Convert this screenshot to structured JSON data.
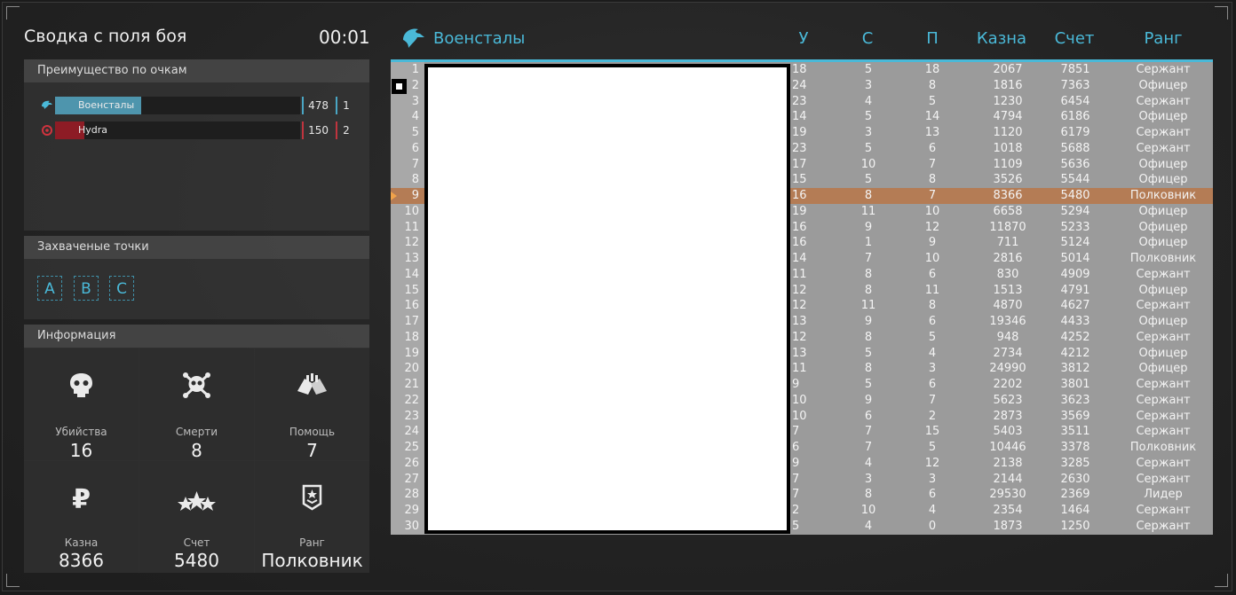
{
  "summary": {
    "title": "Сводка с поля боя",
    "timer": "00:01"
  },
  "advantage": {
    "heading": "Преимущество по очкам",
    "teams": [
      {
        "name": "Военсталы",
        "score": "478",
        "place": "1",
        "fill": 0.35,
        "color": "#4e95ad"
      },
      {
        "name": "Hydra",
        "score": "150",
        "place": "2",
        "fill": 0.12,
        "color": "#8d1c25"
      }
    ]
  },
  "captured": {
    "heading": "Захваченые точки",
    "points": [
      "A",
      "B",
      "C"
    ]
  },
  "info": {
    "heading": "Информация",
    "stats": [
      {
        "label": "Убийства",
        "value": "16",
        "icon": "skull-icon"
      },
      {
        "label": "Смерти",
        "value": "8",
        "icon": "skull-crossbones-icon"
      },
      {
        "label": "Помощь",
        "value": "7",
        "icon": "handshake-icon"
      },
      {
        "label": "Казна",
        "value": "8366",
        "icon": "ruble-icon"
      },
      {
        "label": "Счет",
        "value": "5480",
        "icon": "three-stars-icon"
      },
      {
        "label": "Ранг",
        "value": "Полковник",
        "icon": "rank-badge-icon"
      }
    ]
  },
  "scoreboard": {
    "team": "Военсталы",
    "columns": {
      "u": "У",
      "s": "С",
      "p": "П",
      "k": "Казна",
      "c": "Счет",
      "r": "Ранг"
    },
    "highlight_row": 9,
    "accent": "#4ab9d8",
    "rows": [
      {
        "n": "1",
        "u": "18",
        "s": "5",
        "p": "18",
        "k": "2067",
        "c": "7851",
        "r": "Сержант"
      },
      {
        "n": "2",
        "u": "24",
        "s": "3",
        "p": "8",
        "k": "1816",
        "c": "7363",
        "r": "Офицер"
      },
      {
        "n": "3",
        "u": "23",
        "s": "4",
        "p": "5",
        "k": "1230",
        "c": "6454",
        "r": "Сержант"
      },
      {
        "n": "4",
        "u": "14",
        "s": "5",
        "p": "14",
        "k": "4794",
        "c": "6186",
        "r": "Офицер"
      },
      {
        "n": "5",
        "u": "19",
        "s": "3",
        "p": "13",
        "k": "1120",
        "c": "6179",
        "r": "Сержант"
      },
      {
        "n": "6",
        "u": "23",
        "s": "5",
        "p": "6",
        "k": "1018",
        "c": "5688",
        "r": "Сержант"
      },
      {
        "n": "7",
        "u": "17",
        "s": "10",
        "p": "7",
        "k": "1109",
        "c": "5636",
        "r": "Офицер"
      },
      {
        "n": "8",
        "u": "15",
        "s": "5",
        "p": "8",
        "k": "3526",
        "c": "5544",
        "r": "Офицер"
      },
      {
        "n": "9",
        "u": "16",
        "s": "8",
        "p": "7",
        "k": "8366",
        "c": "5480",
        "r": "Полковник"
      },
      {
        "n": "10",
        "u": "19",
        "s": "11",
        "p": "10",
        "k": "6658",
        "c": "5294",
        "r": "Офицер"
      },
      {
        "n": "11",
        "u": "16",
        "s": "9",
        "p": "12",
        "k": "11870",
        "c": "5233",
        "r": "Офицер"
      },
      {
        "n": "12",
        "u": "16",
        "s": "1",
        "p": "9",
        "k": "711",
        "c": "5124",
        "r": "Офицер"
      },
      {
        "n": "13",
        "u": "14",
        "s": "7",
        "p": "10",
        "k": "2816",
        "c": "5014",
        "r": "Полковник"
      },
      {
        "n": "14",
        "u": "11",
        "s": "8",
        "p": "6",
        "k": "830",
        "c": "4909",
        "r": "Сержант"
      },
      {
        "n": "15",
        "u": "12",
        "s": "8",
        "p": "11",
        "k": "1513",
        "c": "4791",
        "r": "Офицер"
      },
      {
        "n": "16",
        "u": "12",
        "s": "11",
        "p": "8",
        "k": "4870",
        "c": "4627",
        "r": "Сержант"
      },
      {
        "n": "17",
        "u": "13",
        "s": "9",
        "p": "6",
        "k": "19346",
        "c": "4433",
        "r": "Офицер"
      },
      {
        "n": "18",
        "u": "12",
        "s": "8",
        "p": "5",
        "k": "948",
        "c": "4252",
        "r": "Сержант"
      },
      {
        "n": "19",
        "u": "13",
        "s": "5",
        "p": "4",
        "k": "2734",
        "c": "4212",
        "r": "Офицер"
      },
      {
        "n": "20",
        "u": "11",
        "s": "8",
        "p": "3",
        "k": "24990",
        "c": "3812",
        "r": "Офицер"
      },
      {
        "n": "21",
        "u": "9",
        "s": "5",
        "p": "6",
        "k": "2202",
        "c": "3801",
        "r": "Сержант"
      },
      {
        "n": "22",
        "u": "10",
        "s": "9",
        "p": "7",
        "k": "5623",
        "c": "3623",
        "r": "Сержант"
      },
      {
        "n": "23",
        "u": "10",
        "s": "6",
        "p": "2",
        "k": "2873",
        "c": "3569",
        "r": "Сержант"
      },
      {
        "n": "24",
        "u": "7",
        "s": "7",
        "p": "15",
        "k": "5403",
        "c": "3511",
        "r": "Сержант"
      },
      {
        "n": "25",
        "u": "6",
        "s": "7",
        "p": "5",
        "k": "10446",
        "c": "3378",
        "r": "Полковник"
      },
      {
        "n": "26",
        "u": "9",
        "s": "4",
        "p": "12",
        "k": "2138",
        "c": "3285",
        "r": "Сержант"
      },
      {
        "n": "27",
        "u": "7",
        "s": "3",
        "p": "3",
        "k": "2144",
        "c": "2630",
        "r": "Сержант"
      },
      {
        "n": "28",
        "u": "7",
        "s": "8",
        "p": "6",
        "k": "29530",
        "c": "2369",
        "r": "Лидер"
      },
      {
        "n": "29",
        "u": "2",
        "s": "10",
        "p": "4",
        "k": "2354",
        "c": "1464",
        "r": "Сержант"
      },
      {
        "n": "30",
        "u": "5",
        "s": "4",
        "p": "0",
        "k": "1873",
        "c": "1250",
        "r": "Сержант"
      }
    ]
  }
}
